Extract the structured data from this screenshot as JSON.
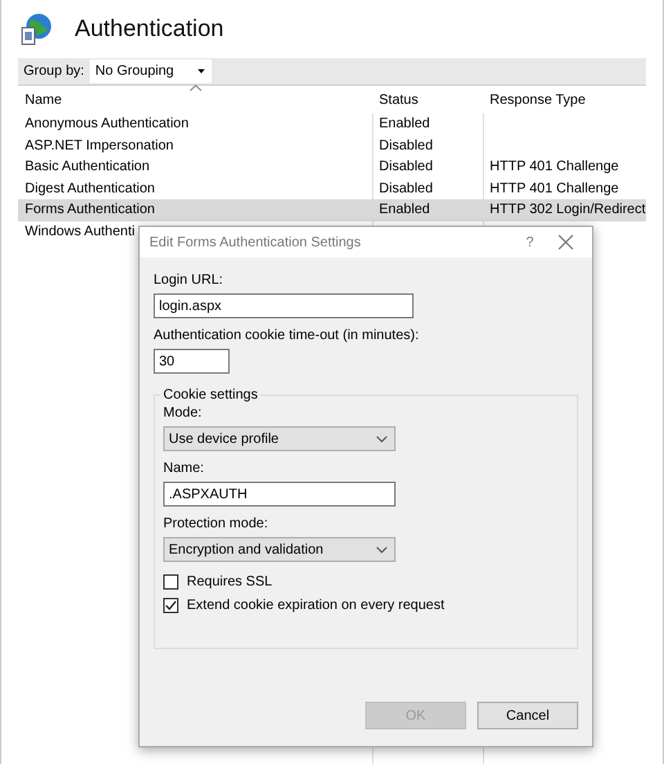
{
  "page": {
    "title": "Authentication"
  },
  "toolbar": {
    "group_by_label": "Group by:",
    "group_by_value": "No Grouping"
  },
  "table": {
    "columns": [
      "Name",
      "Status",
      "Response Type"
    ],
    "rows": [
      {
        "cells": [
          "Anonymous Authentication",
          "Enabled"
        ],
        "selected": false
      },
      {
        "cells": [
          "ASP.NET Impersonation",
          "Disabled"
        ],
        "selected": false
      },
      {
        "cells": [
          "Basic Authentication",
          "Disabled",
          "HTTP 401 Challenge"
        ],
        "selected": false
      },
      {
        "cells": [
          "Digest Authentication",
          "Disabled",
          "HTTP 401 Challenge"
        ],
        "selected": false
      },
      {
        "cells": [
          "Forms Authentication",
          "Enabled",
          "HTTP 302 Login/Redirect"
        ],
        "selected": true
      },
      {
        "cells": [
          "Windows Authenti"
        ],
        "selected": false
      }
    ]
  },
  "dialog": {
    "title": "Edit Forms Authentication Settings",
    "help_button": "?",
    "login_url": {
      "label": "Login URL:",
      "value": "login.aspx"
    },
    "timeout": {
      "label": "Authentication cookie time-out (in minutes):",
      "value": "30"
    },
    "cookie_settings": {
      "legend": "Cookie settings",
      "mode": {
        "label": "Mode:",
        "value": "Use device profile"
      },
      "name": {
        "label": "Name:",
        "value": ".ASPXAUTH"
      },
      "protection_mode": {
        "label": "Protection mode:",
        "value": "Encryption and validation"
      },
      "checkboxes": [
        {
          "label": "Requires SSL",
          "checked": false
        },
        {
          "label": "Extend cookie expiration on every request",
          "checked": true
        }
      ]
    },
    "buttons": [
      {
        "label": "OK",
        "disabled": true
      },
      {
        "label": "Cancel",
        "disabled": false
      }
    ]
  }
}
